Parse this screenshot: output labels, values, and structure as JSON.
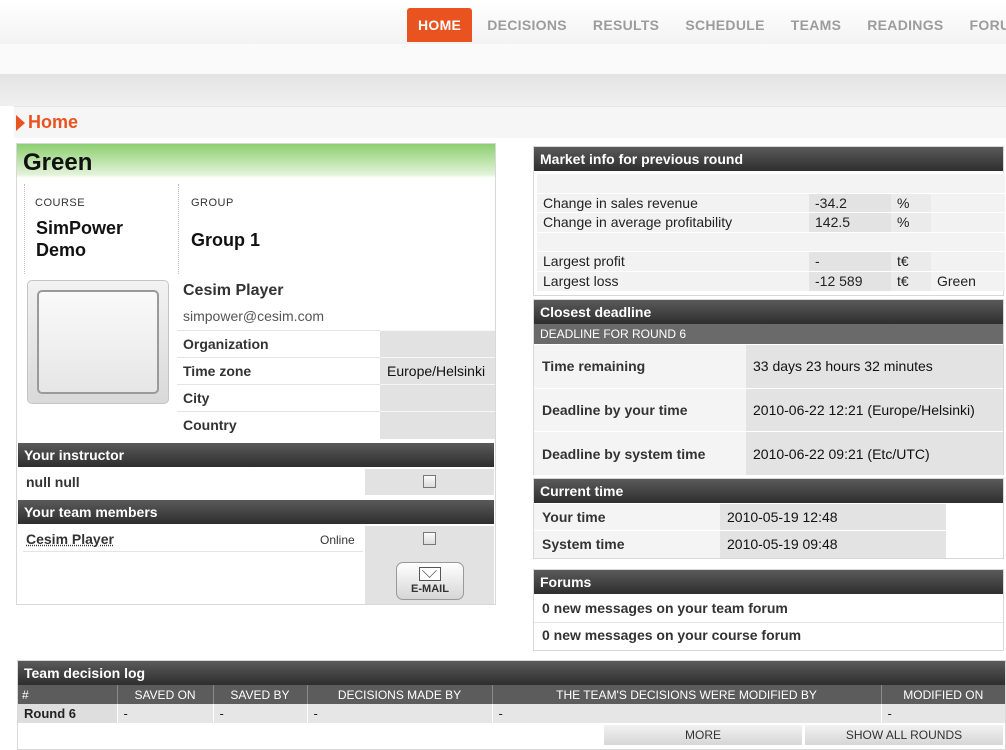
{
  "nav": {
    "items": [
      {
        "label": "HOME",
        "active": true
      },
      {
        "label": "DECISIONS",
        "active": false
      },
      {
        "label": "RESULTS",
        "active": false
      },
      {
        "label": "SCHEDULE",
        "active": false
      },
      {
        "label": "TEAMS",
        "active": false
      },
      {
        "label": "READINGS",
        "active": false
      },
      {
        "label": "FORUMS",
        "active": false
      }
    ]
  },
  "page": {
    "title": "Home"
  },
  "profile": {
    "team_name": "Green",
    "course_label": "COURSE",
    "course_value": "SimPower Demo",
    "group_label": "GROUP",
    "group_value": "Group 1",
    "player_name": "Cesim Player",
    "email": "simpower@cesim.com",
    "fields": [
      {
        "label": "Organization",
        "value": ""
      },
      {
        "label": "Time zone",
        "value": "Europe/Helsinki"
      },
      {
        "label": "City",
        "value": ""
      },
      {
        "label": "Country",
        "value": ""
      }
    ]
  },
  "instructor": {
    "heading": "Your instructor",
    "name": "null null"
  },
  "team_members": {
    "heading": "Your team members",
    "members": [
      {
        "name": "Cesim Player",
        "status": "Online"
      }
    ],
    "email_button": "E-MAIL"
  },
  "market_info": {
    "heading": "Market info for previous round",
    "rows": [
      {
        "label": "Change in sales revenue",
        "value": "-34.2",
        "unit": "%",
        "team": ""
      },
      {
        "label": "Change in average profitability",
        "value": "142.5",
        "unit": "%",
        "team": ""
      },
      {
        "label": "Largest profit",
        "value": "-",
        "unit": "t€",
        "team": ""
      },
      {
        "label": "Largest loss",
        "value": "-12 589",
        "unit": "t€",
        "team": "Green"
      }
    ]
  },
  "deadline": {
    "heading": "Closest deadline",
    "subheading": "DEADLINE FOR ROUND 6",
    "rows": [
      {
        "label": "Time remaining",
        "value": "33 days 23 hours 32 minutes"
      },
      {
        "label": "Deadline by your time",
        "value": "2010-06-22 12:21 (Europe/Helsinki)"
      },
      {
        "label": "Deadline by system time",
        "value": "2010-06-22 09:21 (Etc/UTC)"
      }
    ]
  },
  "current_time": {
    "heading": "Current time",
    "rows": [
      {
        "label": "Your time",
        "value": "2010-05-19 12:48"
      },
      {
        "label": "System time",
        "value": "2010-05-19 09:48"
      }
    ]
  },
  "forums": {
    "heading": "Forums",
    "team_forum": "0 new messages on your team forum",
    "course_forum": "0 new messages on your course forum"
  },
  "decision_log": {
    "heading": "Team decision log",
    "columns": [
      "#",
      "SAVED ON",
      "SAVED BY",
      "DECISIONS MADE BY",
      "THE TEAM'S DECISIONS WERE MODIFIED BY",
      "MODIFIED ON"
    ],
    "rows": [
      [
        "Round 6",
        "-",
        "-",
        "-",
        "-",
        "-"
      ]
    ],
    "more_label": "MORE",
    "show_all_label": "SHOW ALL ROUNDS"
  }
}
